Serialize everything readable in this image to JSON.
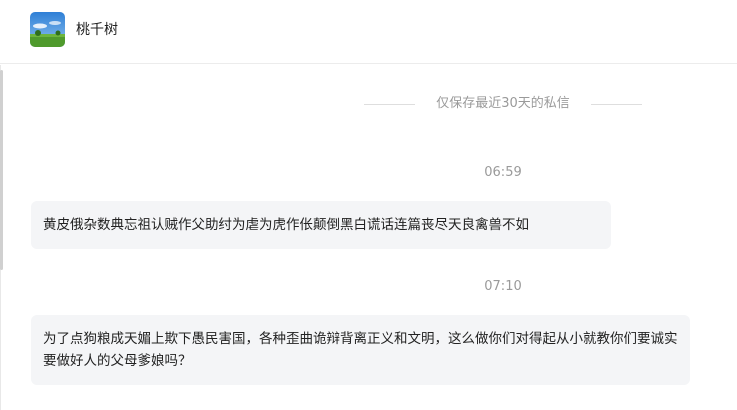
{
  "header": {
    "contact_name": "桃千树",
    "avatar_icon": "landscape-avatar"
  },
  "notice": {
    "text": "仅保存最近30天的私信"
  },
  "messages": [
    {
      "time": "06:59",
      "text": "黄皮俄杂数典忘祖认贼作父助纣为虐为虎作伥颠倒黑白谎话连篇丧尽天良禽兽不如"
    },
    {
      "time": "07:10",
      "text": "为了点狗粮成天媚上欺下愚民害国，各种歪曲诡辩背离正义和文明，这么做你们对得起从小就教你们要诚实要做好人的父母爹娘吗？"
    }
  ],
  "colors": {
    "bubble_bg": "#f4f5f7",
    "meta_text": "#9a9a9a"
  }
}
